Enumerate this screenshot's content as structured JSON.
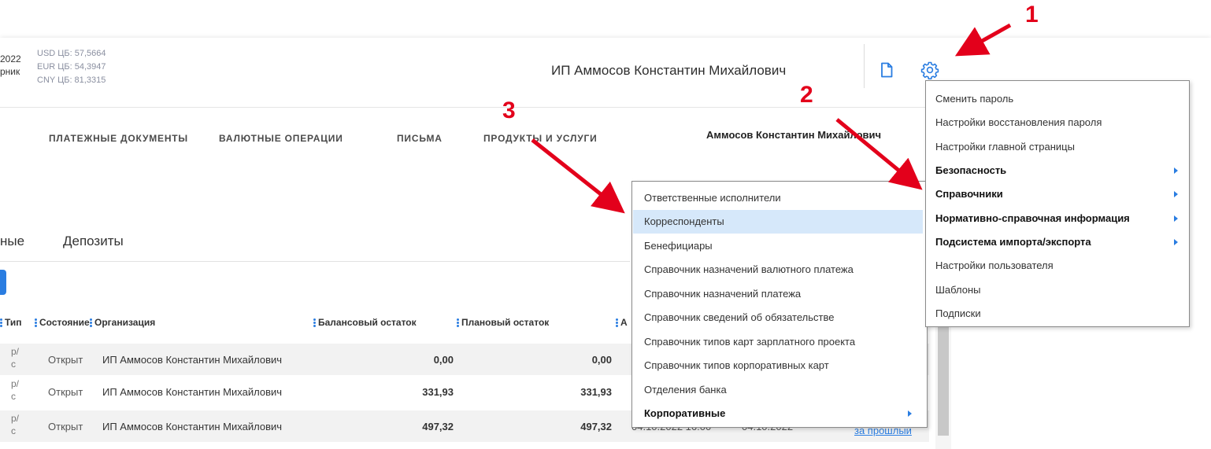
{
  "header": {
    "date_fragment": "2022",
    "day_fragment": "рник",
    "rates": [
      "USD ЦБ: 57,5664",
      "EUR ЦБ: 54,3947",
      "CNY ЦБ: 81,3315"
    ],
    "company": "ИП Аммосов Константин Михайлович"
  },
  "nav": {
    "items": [
      "ПЛАТЕЖНЫЕ ДОКУМЕНТЫ",
      "ВАЛЮТНЫЕ ОПЕРАЦИИ",
      "ПИСЬМА",
      "ПРОДУКТЫ И УСЛУГИ"
    ],
    "user": "Аммосов Константин Михайлович"
  },
  "tabs": [
    "ные",
    "Депозиты"
  ],
  "table": {
    "columns": [
      "Тип",
      "Состояние",
      "Организация",
      "Балансовый остаток",
      "Плановый остаток",
      "А"
    ],
    "rows": [
      {
        "type": "р/\nс",
        "state": "Открыт",
        "org": "ИП Аммосов Константин Михайлович",
        "balance": "0,00",
        "planned": "0,00"
      },
      {
        "type": "р/\nс",
        "state": "Открыт",
        "org": "ИП Аммосов Константин Михайлович",
        "balance": "331,93",
        "planned": "331,93"
      },
      {
        "type": "р/\nс",
        "state": "Открыт",
        "org": "ИП Аммосов Константин Михайлович",
        "balance": "497,32",
        "planned": "497,32",
        "date1": "04.10.2022 16:00",
        "date2": "04.10.2022",
        "link": "за прошлый"
      }
    ]
  },
  "settings_menu": {
    "items": [
      {
        "label": "Сменить пароль",
        "bold": false
      },
      {
        "label": "Настройки восстановления пароля",
        "bold": false
      },
      {
        "label": "Настройки главной страницы",
        "bold": false
      },
      {
        "label": "Безопасность",
        "bold": true,
        "submenu": true
      },
      {
        "label": "Справочники",
        "bold": true,
        "submenu": true
      },
      {
        "label": "Нормативно-справочная информация",
        "bold": true,
        "submenu": true
      },
      {
        "label": "Подсистема импорта/экспорта",
        "bold": true,
        "submenu": true
      },
      {
        "label": "Настройки пользователя",
        "bold": false
      },
      {
        "label": "Шаблоны",
        "bold": false
      },
      {
        "label": "Подписки",
        "bold": false
      }
    ]
  },
  "directories_submenu": {
    "items": [
      {
        "label": "Ответственные исполнители",
        "bold": false
      },
      {
        "label": "Корреспонденты",
        "bold": false,
        "highlighted": true
      },
      {
        "label": "Бенефициары",
        "bold": false
      },
      {
        "label": "Справочник назначений валютного платежа",
        "bold": false
      },
      {
        "label": "Справочник назначений платежа",
        "bold": false
      },
      {
        "label": "Справочник сведений об обязательстве",
        "bold": false
      },
      {
        "label": "Справочник типов карт зарплатного проекта",
        "bold": false
      },
      {
        "label": "Справочник типов корпоративных карт",
        "bold": false
      },
      {
        "label": "Отделения банка",
        "bold": false
      },
      {
        "label": "Корпоративные",
        "bold": true,
        "submenu": true
      }
    ]
  },
  "annotations": [
    "1",
    "2",
    "3"
  ],
  "colors": {
    "accent": "#2a7de1",
    "annotation": "#e3001b",
    "highlight": "#d6e8fa"
  }
}
